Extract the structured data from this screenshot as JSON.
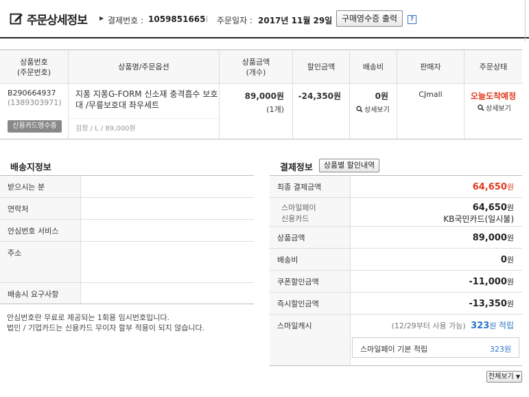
{
  "header": {
    "title": "주문상세정보",
    "payment_label": "결제번호 :",
    "payment_number": "1059851665",
    "order_date_label": "주문일자 :",
    "order_date": "2017년 11월 29일",
    "receipt_button": "구매영수증 출력",
    "help_icon": "?"
  },
  "order_table": {
    "headers": {
      "product_no": [
        "상품번호",
        "(주문번호)"
      ],
      "product_name": "상품명/주문옵션",
      "price": [
        "상품금액",
        "(개수)"
      ],
      "discount": "할인금액",
      "shipping": "배송비",
      "seller": "판매자",
      "status": "주문상태"
    },
    "row": {
      "product_no": "B290664937",
      "order_no": "(1389303971)",
      "card_receipt_button": "신용카드영수증",
      "product_name": "지퐁 지퐁G-FORM 신소재 충격흡수 보호대 /무릎보호대 좌우세트",
      "option": "검정 / L / 89,000원",
      "price": "89,000원",
      "quantity": "(1개)",
      "discount": "-24,350원",
      "shipping_fee": "0원",
      "shipping_detail": "상세보기",
      "seller": "CJmall",
      "status": "오늘도착예정",
      "status_detail": "상세보기"
    }
  },
  "delivery": {
    "title": "배송지정보",
    "rows": [
      "받으시는 분",
      "연락처",
      "안심번호 서비스",
      "주소",
      "배송시 요구사항"
    ],
    "notes": [
      "안심번호란 무료로 제공되는 1회용 임시번호입니다.",
      "법인 / 기업카드는 신용카드 무이자 할부 적용이 되지 않습니다."
    ]
  },
  "payment": {
    "title": "결제정보",
    "discount_detail_button": "상품별 할인내역",
    "final_label": "최종 결제금액",
    "final_amount": "64,650",
    "smilepay_label": "스마일페이",
    "credit_label": "신용카드",
    "smilepay_amount": "64,650",
    "card_name": "KB국민카드(일시불)",
    "product_amount_label": "상품금액",
    "product_amount": "89,000",
    "shipping_label": "배송비",
    "shipping_amount": "0",
    "coupon_label": "쿠폰할인금액",
    "coupon_amount": "-11,000",
    "instant_label": "즉시할인금액",
    "instant_amount": "-13,350",
    "cash_label": "스마일캐시",
    "cash_note": "(12/29부터 사용 가능)",
    "cash_amount": "323",
    "cash_suffix": "적립",
    "cash_basic_label": "스마일페이 기본 적립",
    "cash_basic_amount": "323원",
    "currency_unit": "원",
    "more_button": "전체보기"
  },
  "colors": {
    "accent_red": "#e03a1e",
    "accent_blue": "#2a73c8"
  }
}
